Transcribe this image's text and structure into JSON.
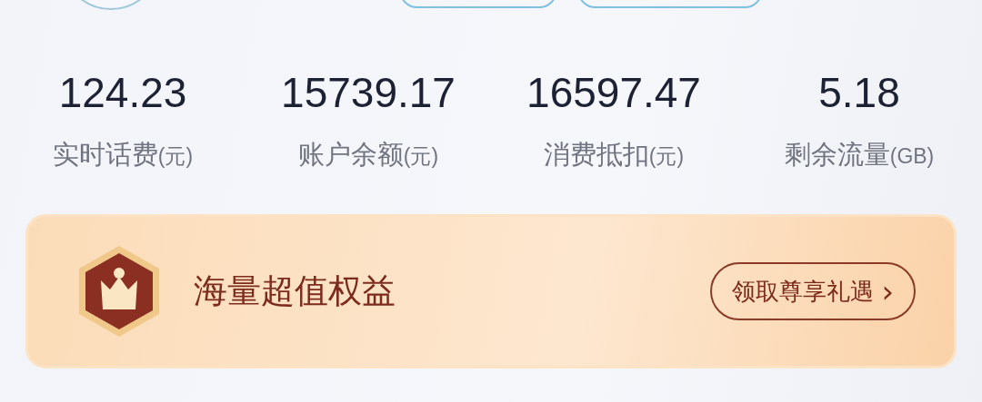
{
  "stats": [
    {
      "value": "124.23",
      "label": "实时话费",
      "unit": "(元)"
    },
    {
      "value": "15739.17",
      "label": "账户余额",
      "unit": "(元)"
    },
    {
      "value": "16597.47",
      "label": "消费抵扣",
      "unit": "(元)"
    },
    {
      "value": "5.18",
      "label": "剩余流量",
      "unit": "(GB)"
    }
  ],
  "banner": {
    "title": "海量超值权益",
    "button": "领取尊享礼遇",
    "button_arrow": "›"
  }
}
